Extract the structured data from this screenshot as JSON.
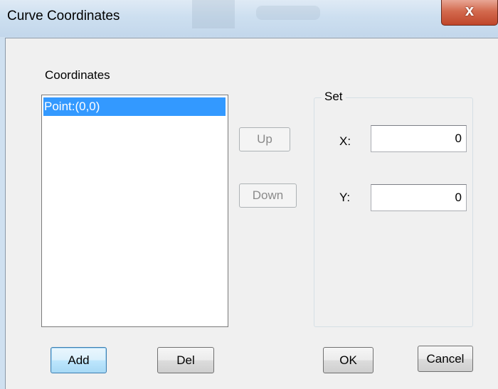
{
  "window": {
    "title": "Curve Coordinates",
    "close_label": "x"
  },
  "coordinates": {
    "label": "Coordinates",
    "items": [
      "Point:(0,0)"
    ],
    "selected_index": 0
  },
  "buttons": {
    "up": "Up",
    "down": "Down",
    "add": "Add",
    "del": "Del",
    "ok": "OK",
    "cancel": "Cancel"
  },
  "set_group": {
    "title": "Set",
    "x_label": "X:",
    "x_value": "0",
    "y_label": "Y:",
    "y_value": "0"
  },
  "colors": {
    "selection": "#3399ff",
    "dialog_background": "#f0f0f0",
    "close_button": "#c7462b"
  },
  "icons": {
    "close": "close-icon"
  }
}
